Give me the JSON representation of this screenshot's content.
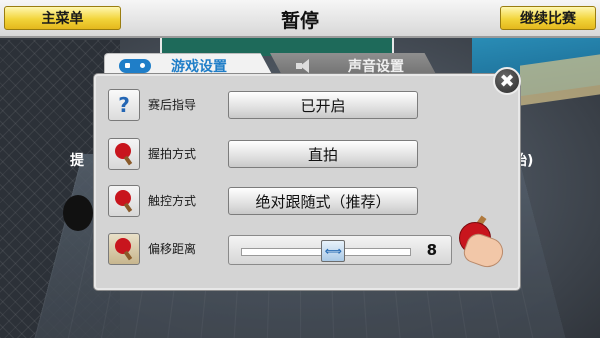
{
  "topbar": {
    "menu_label": "主菜单",
    "title": "暂停",
    "continue_label": "继续比赛"
  },
  "background": {
    "left_fragment": "提",
    "right_fragment": "始)"
  },
  "tabs": [
    {
      "label": "游戏设置",
      "active": true,
      "icon": "gamepad-icon"
    },
    {
      "label": "声音设置",
      "active": false,
      "icon": "speaker-icon"
    }
  ],
  "settings": {
    "guide": {
      "label": "赛后指导",
      "value": "已开启",
      "icon": "help-icon",
      "icon_text": "?"
    },
    "grip": {
      "label": "握拍方式",
      "value": "直拍",
      "icon": "paddle-icon"
    },
    "touch": {
      "label": "触控方式",
      "value": "绝对跟随式（推荐）",
      "icon": "paddle-icon"
    },
    "offset": {
      "label": "偏移距离",
      "value": "8",
      "slider_fraction": 0.55,
      "icon": "offset-book-icon"
    }
  },
  "close": {
    "symbol": "✖"
  },
  "colors": {
    "accent": "#1f7ec8",
    "button_yellow": "#f2d43a",
    "paddle_red": "#c8151d"
  }
}
